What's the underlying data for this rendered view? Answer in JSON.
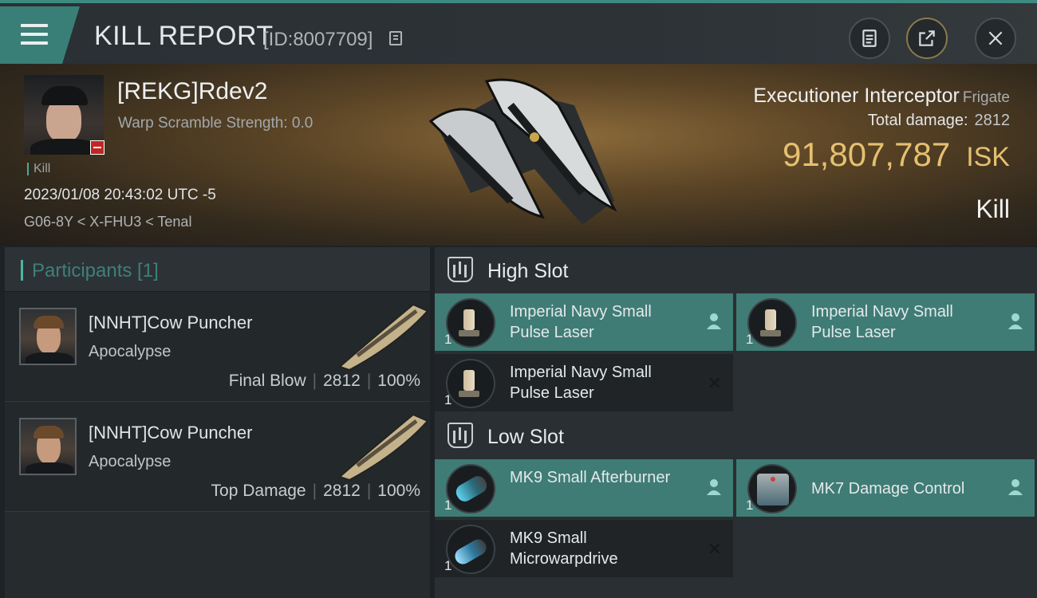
{
  "header": {
    "title": "KILL REPORT",
    "report_id": "[ID:8007709]"
  },
  "victim": {
    "name": "[REKG]Rdev2",
    "warp_scramble": "Warp Scramble Strength: 0.0",
    "tag": "Kill",
    "date": "2023/01/08 20:43:02 UTC -5",
    "location": "G06-8Y < X-FHU3 < Tenal",
    "ship_name": "Executioner Interceptor",
    "ship_class": "Frigate",
    "total_damage_label": "Total damage:",
    "total_damage": "2812",
    "isk_value": "91,807,787",
    "isk_unit": "ISK",
    "outcome": "Kill"
  },
  "participants": {
    "title": "Participants [1]",
    "rows": [
      {
        "name": "[NNHT]Cow Puncher",
        "ship": "Apocalypse",
        "role": "Final Blow",
        "damage": "2812",
        "percent": "100%"
      },
      {
        "name": "[NNHT]Cow Puncher",
        "ship": "Apocalypse",
        "role": "Top Damage",
        "damage": "2812",
        "percent": "100%"
      }
    ]
  },
  "fitting": {
    "high_slot": {
      "label": "High Slot",
      "modules": [
        {
          "name": "Imperial Navy Small Pulse Laser",
          "qty": "1",
          "state": "fitted"
        },
        {
          "name": "Imperial Navy Small Pulse Laser",
          "qty": "1",
          "state": "fitted"
        },
        {
          "name": "Imperial Navy Small Pulse Laser",
          "qty": "1",
          "state": "destroyed"
        }
      ]
    },
    "low_slot": {
      "label": "Low Slot",
      "modules": [
        {
          "name": "MK9 Small Afterburner",
          "qty": "1",
          "state": "fitted"
        },
        {
          "name": "MK7 Damage Control",
          "qty": "1",
          "state": "fitted"
        },
        {
          "name": "MK9 Small Microwarpdrive",
          "qty": "1",
          "state": "destroyed"
        }
      ]
    }
  },
  "colors": {
    "accent": "#3f7c75",
    "isk": "#e6c070",
    "badge": "#c22525"
  }
}
